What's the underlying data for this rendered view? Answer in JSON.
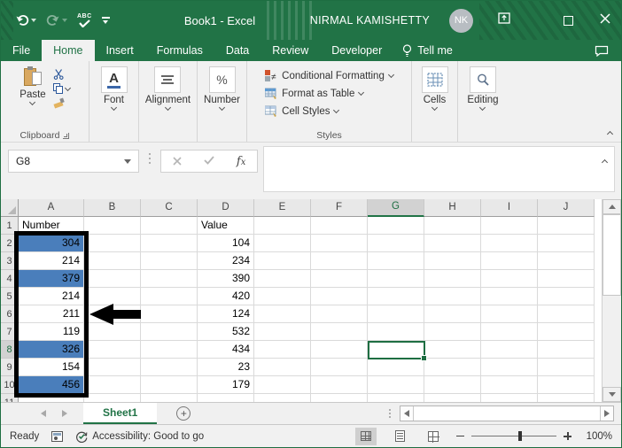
{
  "titlebar": {
    "title": "Book1 - Excel",
    "user_name": "NIRMAL KAMISHETTY",
    "user_initials": "NK"
  },
  "menubar": {
    "tabs": [
      {
        "label": "File",
        "active": false
      },
      {
        "label": "Home",
        "active": true
      },
      {
        "label": "Insert",
        "active": false
      },
      {
        "label": "Formulas",
        "active": false
      },
      {
        "label": "Data",
        "active": false
      },
      {
        "label": "Review",
        "active": false
      },
      {
        "label": "Developer",
        "active": false
      }
    ],
    "tell_me": "Tell me"
  },
  "ribbon": {
    "paste_label": "Paste",
    "clipboard_label": "Clipboard",
    "font_label": "Font",
    "alignment_label": "Alignment",
    "number_label": "Number",
    "conditional_formatting_label": "Conditional Formatting",
    "format_as_table_label": "Format as Table",
    "cell_styles_label": "Cell Styles",
    "styles_label": "Styles",
    "cells_label": "Cells",
    "editing_label": "Editing"
  },
  "formula_bar": {
    "name_box_value": "G8",
    "formula_value": ""
  },
  "sheet": {
    "visible_columns": [
      "A",
      "B",
      "C",
      "D",
      "E",
      "F",
      "G",
      "H",
      "I",
      "J"
    ],
    "selected_cell": "G8",
    "selected_column": "G",
    "selected_row": 8,
    "rows": [
      {
        "n": "1",
        "A": "Number",
        "D": "Value",
        "a_highlight": false
      },
      {
        "n": "2",
        "A": "304",
        "D": "104",
        "a_highlight": true
      },
      {
        "n": "3",
        "A": "214",
        "D": "234",
        "a_highlight": false
      },
      {
        "n": "4",
        "A": "379",
        "D": "390",
        "a_highlight": true
      },
      {
        "n": "5",
        "A": "214",
        "D": "420",
        "a_highlight": false
      },
      {
        "n": "6",
        "A": "211",
        "D": "124",
        "a_highlight": false
      },
      {
        "n": "7",
        "A": "119",
        "D": "532",
        "a_highlight": false
      },
      {
        "n": "8",
        "A": "326",
        "D": "434",
        "a_highlight": true
      },
      {
        "n": "9",
        "A": "154",
        "D": "23",
        "a_highlight": false
      },
      {
        "n": "10",
        "A": "456",
        "D": "179",
        "a_highlight": true
      },
      {
        "n": "11",
        "A": "",
        "D": "",
        "a_highlight": false
      }
    ]
  },
  "sheet_tabs": {
    "active_tab": "Sheet1"
  },
  "status_bar": {
    "ready_label": "Ready",
    "accessibility_label": "Accessibility: Good to go",
    "zoom_level": "100%"
  },
  "colors": {
    "excel_green": "#217346",
    "highlight_blue": "#4a7ebb",
    "active_cell_border": "#1e6e42"
  }
}
